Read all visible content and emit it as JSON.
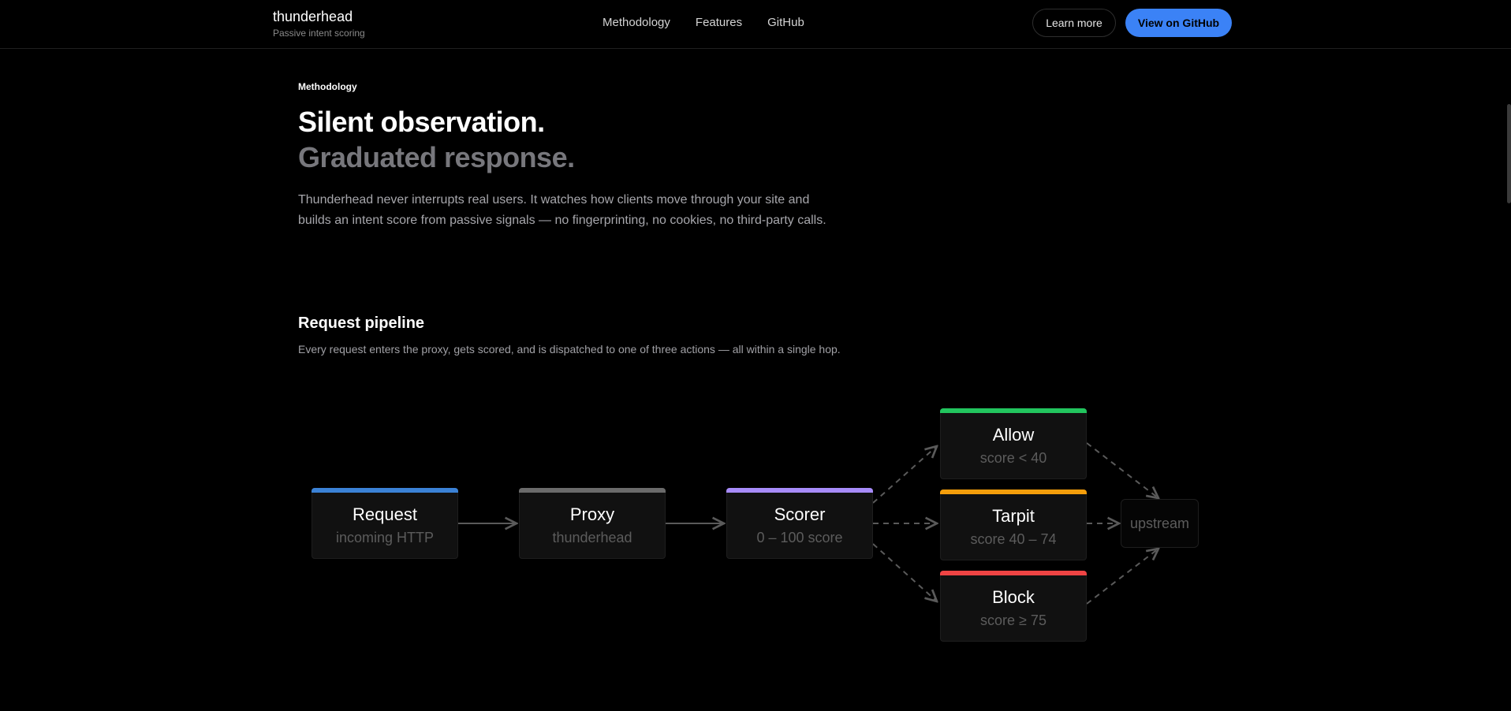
{
  "header": {
    "brand": "thunderhead",
    "tagline": "Passive intent scoring",
    "nav": [
      "Methodology",
      "Features",
      "GitHub"
    ],
    "learn_more": "Learn more",
    "view_github": "View on GitHub"
  },
  "intro": {
    "eyebrow": "Methodology",
    "title_line1": "Silent observation.",
    "title_line2": "Graduated response.",
    "lede": "Thunderhead never interrupts real users. It watches how clients move through your site and builds an intent score from passive signals — no fingerprinting, no cookies, no third-party calls."
  },
  "pipeline": {
    "title": "Request pipeline",
    "subtitle": "Every request enters the proxy, gets scored, and is dispatched to one of three actions — all within a single hop.",
    "nodes": [
      {
        "title": "Request",
        "sub": "incoming HTTP",
        "color": "#3b82d6"
      },
      {
        "title": "Proxy",
        "sub": "thunderhead",
        "color": "#6b6b6b"
      },
      {
        "title": "Scorer",
        "sub": "0 – 100 score",
        "color": "#a78bfa"
      },
      {
        "title": "Allow",
        "sub": "score < 40",
        "color": "#22c55e"
      },
      {
        "title": "Tarpit",
        "sub": "score 40 – 74",
        "color": "#f59e0b"
      },
      {
        "title": "Block",
        "sub": "score ≥ 75",
        "color": "#ef4444"
      }
    ],
    "upstream": "upstream"
  }
}
